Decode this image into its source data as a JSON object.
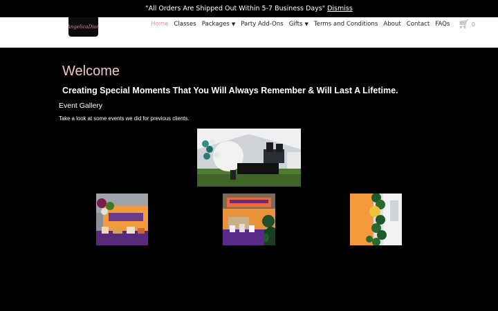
{
  "notice": {
    "text": "\"All Orders Are Shipped Out Within 5-7 Business Days\"",
    "dismiss_label": "Dismiss"
  },
  "header": {
    "logo_text": "AngelicaDion",
    "nav": [
      {
        "label": "Home",
        "active": true
      },
      {
        "label": "Classes"
      },
      {
        "label": "Packages",
        "dropdown": true
      },
      {
        "label": "Party Add-Ons"
      },
      {
        "label": "Gifts",
        "dropdown": true
      },
      {
        "label": "Terms and Conditions"
      },
      {
        "label": "About"
      },
      {
        "label": "Contact"
      },
      {
        "label": "FAQs"
      }
    ],
    "cart_count": "0"
  },
  "main": {
    "welcome": "Welcome",
    "tagline": "Creating Special Moments That You Will Always Remember & Will Last A Lifetime.",
    "gallery_title": "Event Gallery",
    "gallery_subtitle": "Take a look at some events we did for previous clients."
  },
  "colors": {
    "accent": "#e8958f",
    "welcome": "#f2c4c8",
    "background": "#000000"
  }
}
